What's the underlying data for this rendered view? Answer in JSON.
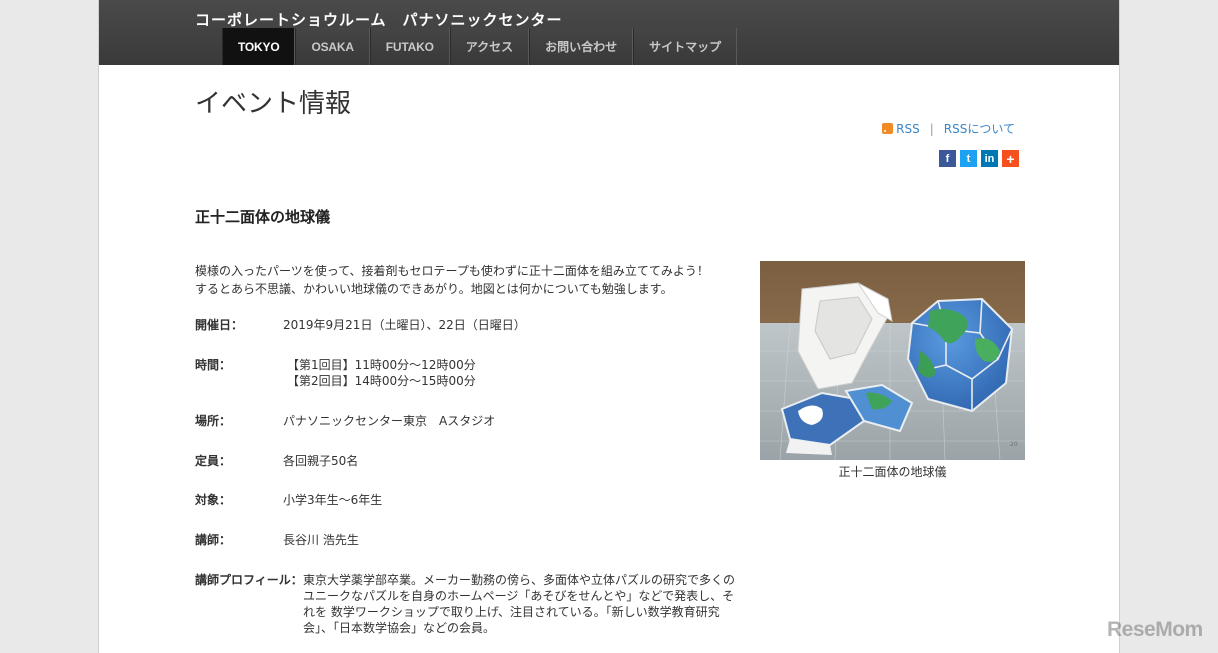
{
  "site_title": "コーポレートショウルーム　パナソニックセンター",
  "nav": [
    "TOKYO",
    "OSAKA",
    "FUTAKO",
    "アクセス",
    "お問い合わせ",
    "サイトマップ"
  ],
  "page_title": "イベント情報",
  "rss": {
    "rss_label": "RSS",
    "about_label": "RSSについて",
    "separator": "|"
  },
  "share_icons": [
    "facebook-icon",
    "twitter-icon",
    "linkedin-icon",
    "plus-icon"
  ],
  "share_glyphs": [
    "f",
    "t",
    "in",
    "+"
  ],
  "event": {
    "title": "正十二面体の地球儀",
    "intro_line1": "模様の入ったパーツを使って、接着剤もセロテープも使わずに正十二面体を組み立ててみよう！",
    "intro_line2": "するとあら不思議、かわいい地球儀のできあがり。地図とは何かについても勉強します。",
    "details": {
      "date_label": "開催日：",
      "date_value": "2019年9月21日（土曜日）、22日（日曜日）",
      "time_label": "時間：",
      "time_value_1": "【第1回目】11時00分～12時00分",
      "time_value_2": "【第2回目】14時00分～15時00分",
      "place_label": "場所：",
      "place_value": "パナソニックセンター東京　Aスタジオ",
      "capacity_label": "定員：",
      "capacity_value": "各回親子50名",
      "target_label": "対象：",
      "target_value": "小学3年生～6年生",
      "lecturer_label": "講師：",
      "lecturer_value": "長谷川 浩先生",
      "profile_label": "講師プロフィール：",
      "profile_value": "東京大学薬学部卒業。メーカー勤務の傍ら、多面体や立体パズルの研究で多くのユニークなパズルを自身のホームページ「あそびをせんとや」などで発表し、それを 数学ワークショップで取り上げ、注目されている。「新しい数学教育研究会」、「日本数学協会」などの会員。"
    },
    "photo_caption": "正十二面体の地球儀"
  },
  "watermark": "ReseMom",
  "colors": {
    "header_bg": "#3f3f3f",
    "link": "#3a86c8",
    "rss_orange": "#f08a24"
  }
}
